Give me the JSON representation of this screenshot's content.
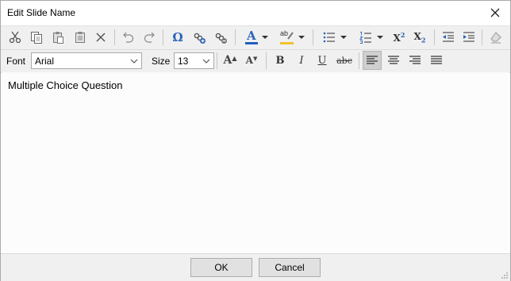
{
  "window": {
    "title": "Edit Slide Name"
  },
  "format_bar": {
    "font_label": "Font",
    "font_value": "Arial",
    "size_label": "Size",
    "size_value": "13"
  },
  "editor": {
    "text": "Multiple Choice Question"
  },
  "footer": {
    "ok_label": "OK",
    "cancel_label": "Cancel"
  },
  "toolbar1": {
    "icons": [
      "cut-icon",
      "copy-icon",
      "paste-icon",
      "paste-special-icon",
      "delete-icon",
      "undo-icon",
      "redo-icon",
      "symbol-icon",
      "insert-link-icon",
      "remove-link-icon",
      "font-color-icon",
      "highlight-color-icon",
      "bulleted-list-icon",
      "numbered-list-icon",
      "superscript-icon",
      "subscript-icon",
      "decrease-indent-icon",
      "increase-indent-icon",
      "clear-formatting-icon"
    ],
    "symbol_glyph": "Ω",
    "font_color_glyph": "A",
    "highlight_glyph": "ab",
    "superscript_glyph": "X",
    "superscript_mark": "2",
    "subscript_glyph": "X",
    "subscript_mark": "2"
  },
  "toolbar2": {
    "grow_glyph": "A",
    "shrink_glyph": "A",
    "bold_glyph": "B",
    "italic_glyph": "I",
    "underline_glyph": "U",
    "strike_glyph": "abc",
    "active_alignment": "left"
  },
  "colors": {
    "font_color": "#1f5fbf",
    "highlight": "#f2c12e",
    "accent_icon": "#2a64b8"
  }
}
